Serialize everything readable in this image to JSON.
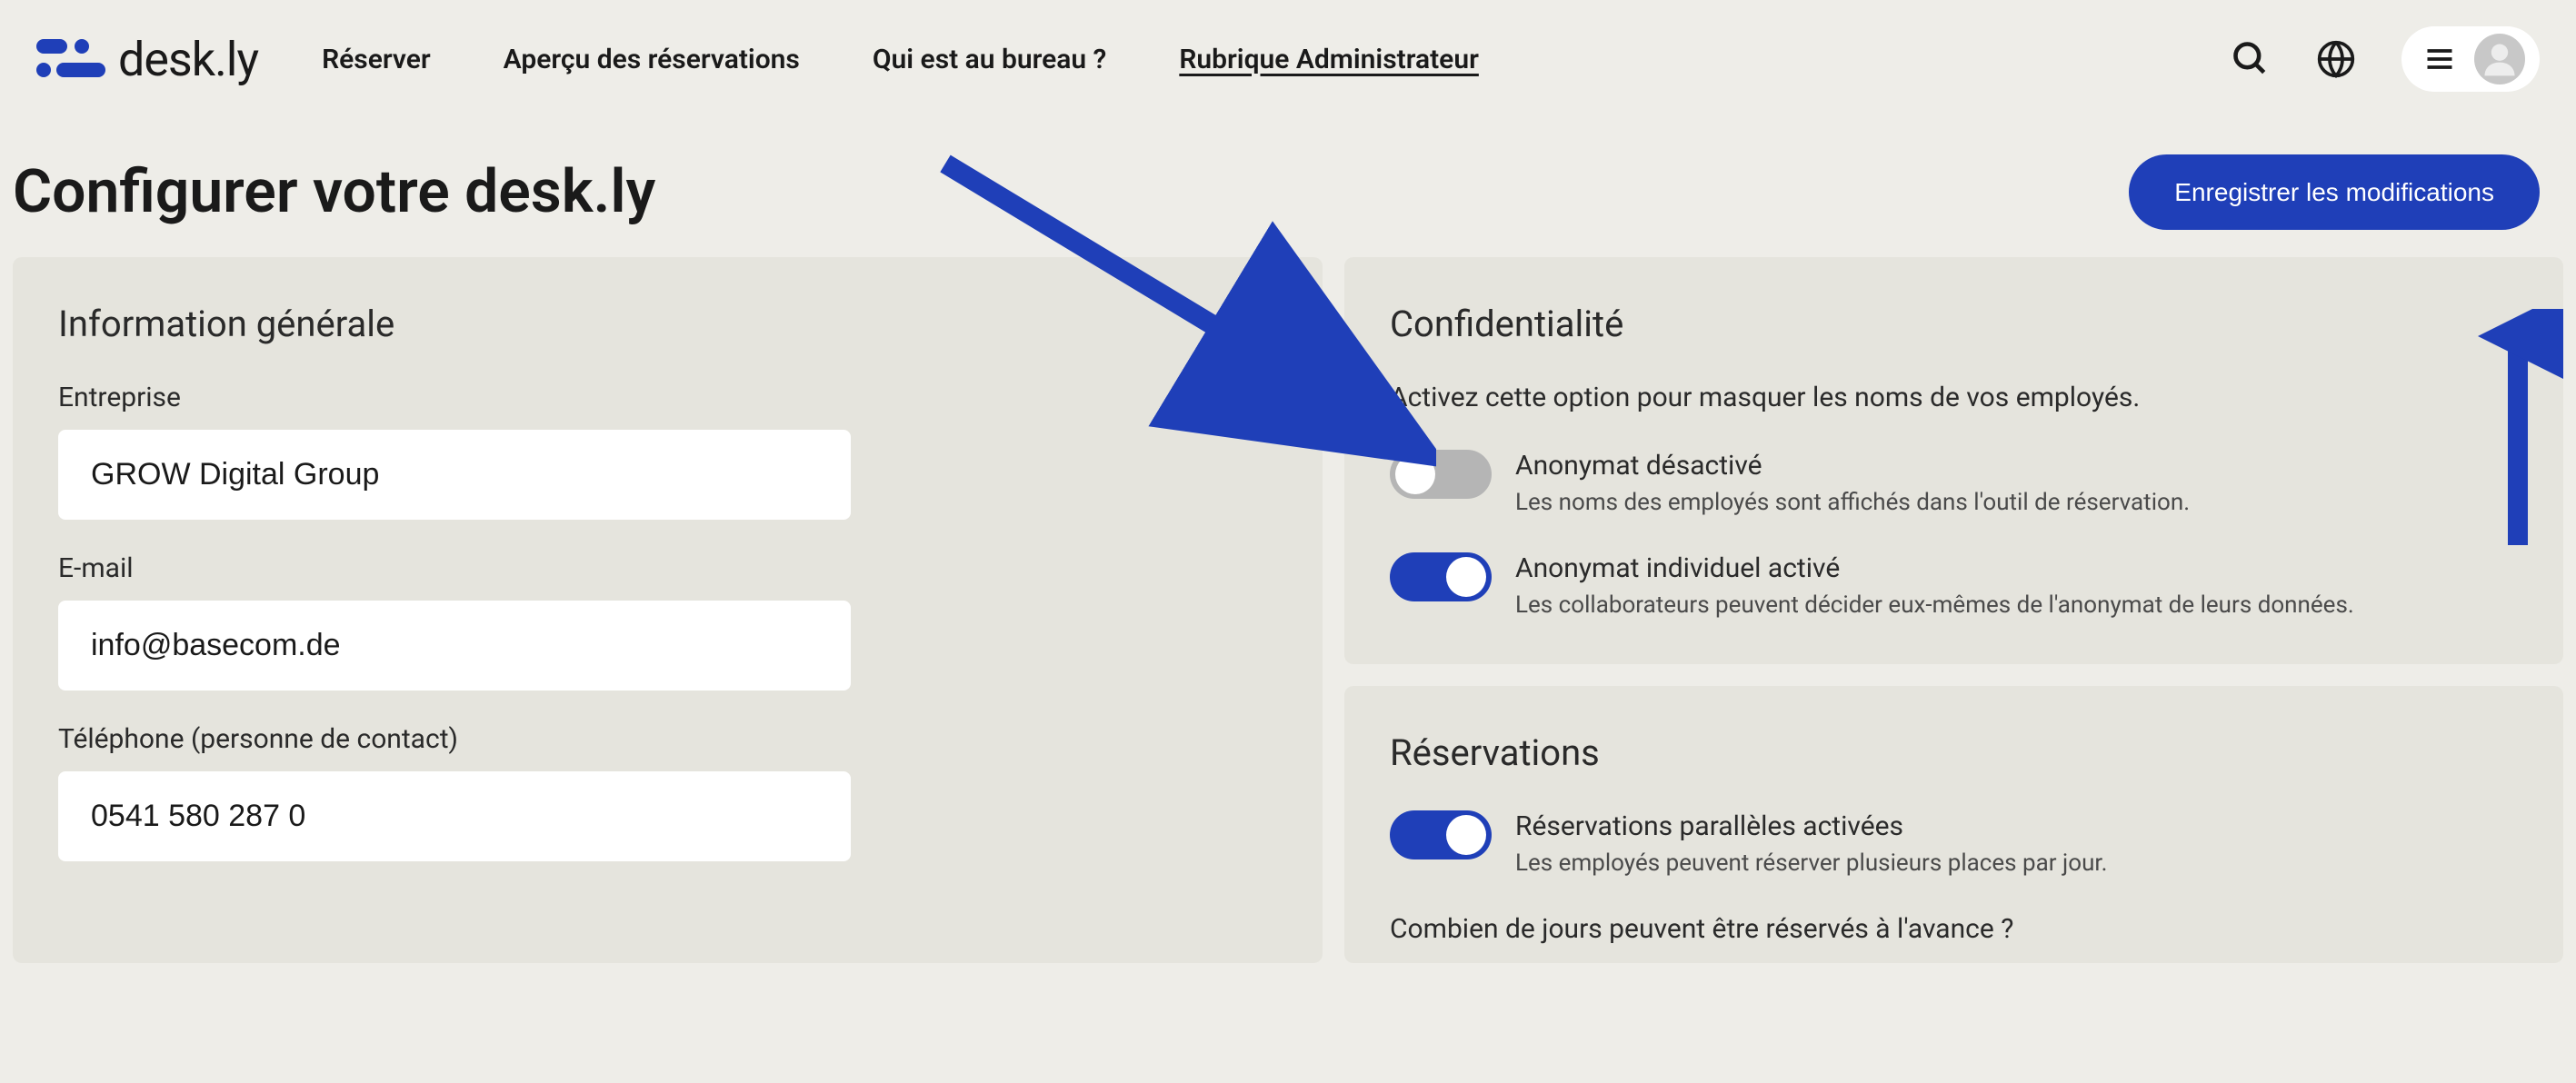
{
  "brand": {
    "name": "desk.ly"
  },
  "nav": {
    "reserve": "Réserver",
    "overview": "Aperçu des réservations",
    "whoInOffice": "Qui est au bureau ?",
    "admin": "Rubrique Administrateur"
  },
  "pageTitle": "Configurer votre desk.ly",
  "saveButton": "Enregistrer les modifications",
  "generalInfo": {
    "title": "Information générale",
    "companyLabel": "Entreprise",
    "companyValue": "GROW Digital Group",
    "emailLabel": "E-mail",
    "emailValue": "info@basecom.de",
    "phoneLabel": "Téléphone (personne de contact)",
    "phoneValue": "0541 580 287 0"
  },
  "privacy": {
    "title": "Confidentialité",
    "description": "Activez cette option pour masquer les noms de vos employés.",
    "anonymityOff": {
      "title": "Anonymat désactivé",
      "sub": "Les noms des employés sont affichés dans l'outil de réservation.",
      "enabled": false
    },
    "anonymityIndividual": {
      "title": "Anonymat individuel activé",
      "sub": "Les collaborateurs peuvent décider eux-mêmes de l'anonymat de leurs données.",
      "enabled": true
    }
  },
  "reservations": {
    "title": "Réservations",
    "parallel": {
      "title": "Réservations parallèles activées",
      "sub": "Les employés peuvent réserver plusieurs places par jour.",
      "enabled": true
    },
    "daysQuestion": "Combien de jours peuvent être réservés à l'avance ?"
  },
  "colors": {
    "primary": "#1f3fb8"
  }
}
